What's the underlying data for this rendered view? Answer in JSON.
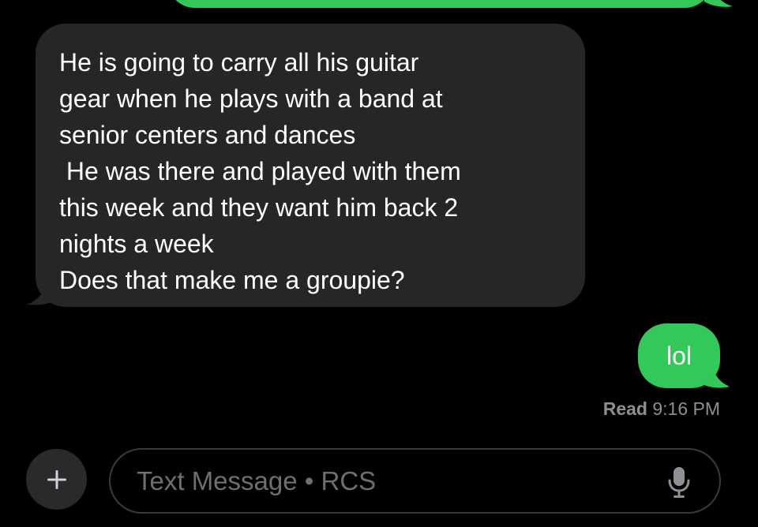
{
  "conversation": {
    "received_message": {
      "lines": [
        "He is going to carry all his guitar",
        "gear when he plays with a band at",
        "senior centers and dances",
        " He was there and played with them",
        "this week and they want him back 2",
        "nights a week",
        "Does that make me a groupie?"
      ]
    },
    "sent_message": {
      "text": "lol"
    },
    "receipt": {
      "status": "Read",
      "time": "9:16 PM"
    }
  },
  "composer": {
    "plus_label": "+",
    "placeholder": "Text Message • RCS"
  },
  "colors": {
    "background": "#000000",
    "sent_bubble": "#34c759",
    "received_bubble": "#262628",
    "secondary_text": "#8e8e93"
  },
  "icons": {
    "add": "plus-icon",
    "dictation": "microphone-icon"
  }
}
